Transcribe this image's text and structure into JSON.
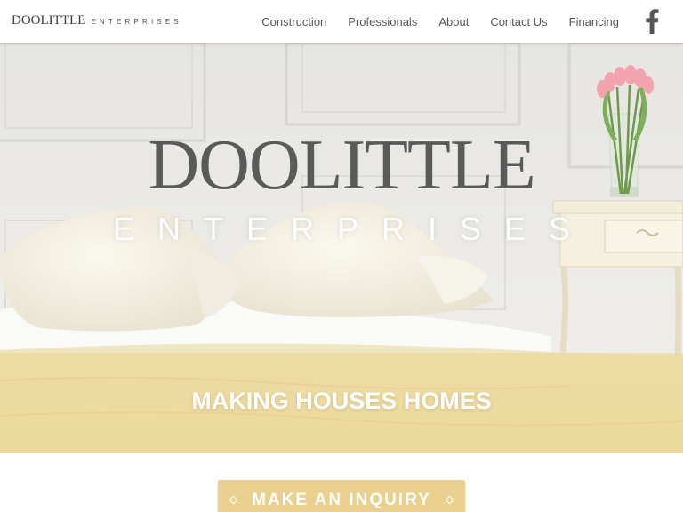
{
  "header": {
    "logo_main": "DOOLITTLE",
    "logo_sub": "ENTERPRISES",
    "nav": [
      "Construction",
      "Professionals",
      "About",
      "Contact Us",
      "Financing"
    ],
    "social_icon": "facebook-icon"
  },
  "hero": {
    "title": "DOOLITTLE",
    "subtitle": "ENTERPRISES",
    "tagline": "MAKING HOUSES HOMES"
  },
  "cta": {
    "label": "MAKE AN INQUIRY"
  },
  "colors": {
    "accent": "#e9d08f",
    "tagline_band": "#ecd68c",
    "text_dark": "#555555"
  }
}
